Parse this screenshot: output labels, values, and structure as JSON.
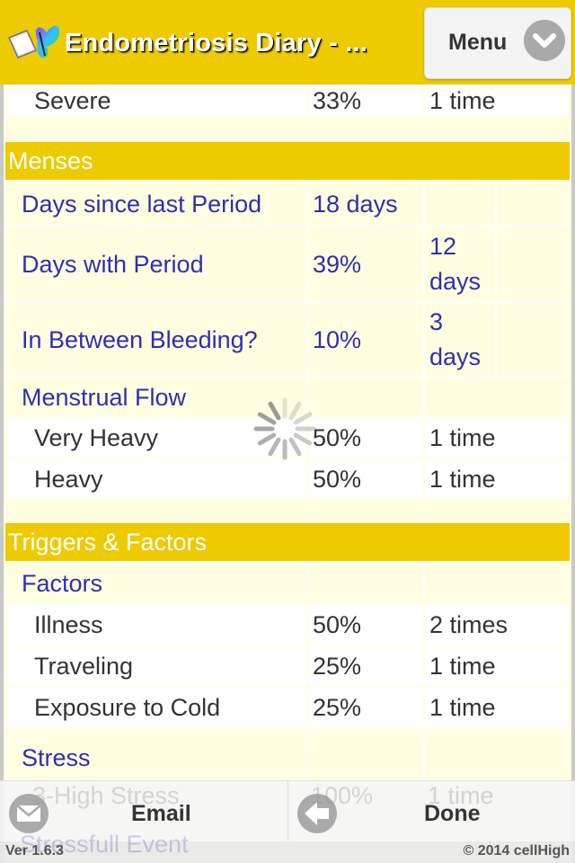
{
  "header": {
    "title": "Endometriosis Diary - ...",
    "menu_label": "Menu",
    "logo_icon": "book-butterfly-icon",
    "menu_icon": "chevron-down-circle-icon"
  },
  "rows_top": [
    {
      "label": "Severe",
      "percent": "33%",
      "count": "1 time"
    }
  ],
  "sections": [
    {
      "title": "Menses",
      "rows": [
        {
          "type": "cat",
          "label": "Days since last Period",
          "percent": "18 days",
          "count": ""
        },
        {
          "type": "cat",
          "label": "Days with Period",
          "percent": "39%",
          "count_line1": "12",
          "count_line2": "days"
        },
        {
          "type": "cat",
          "label": "In Between Bleeding?",
          "percent": "10%",
          "count_line1": "3",
          "count_line2": "days"
        },
        {
          "type": "cat",
          "label": "Menstrual Flow",
          "percent": "",
          "count": ""
        },
        {
          "type": "sub",
          "label": "Very Heavy",
          "percent": "50%",
          "count": "1 time"
        },
        {
          "type": "sub",
          "label": "Heavy",
          "percent": "50%",
          "count": "1 time"
        }
      ]
    },
    {
      "title": "Triggers & Factors",
      "rows": [
        {
          "type": "cat",
          "label": "Factors",
          "percent": "",
          "count": ""
        },
        {
          "type": "sub",
          "label": "Illness",
          "percent": "50%",
          "count": "2 times"
        },
        {
          "type": "sub",
          "label": "Traveling",
          "percent": "25%",
          "count": "1 time"
        },
        {
          "type": "sub",
          "label": "Exposure to Cold",
          "percent": "25%",
          "count": "1 time"
        },
        {
          "type": "cat",
          "label": "Stress",
          "percent": "",
          "count": ""
        },
        {
          "type": "sub",
          "label": "3-High Stress",
          "percent": "100%",
          "count": "1 time"
        },
        {
          "type": "cat",
          "label": "Stressfull Event",
          "percent": "",
          "count": ""
        }
      ]
    }
  ],
  "footer": {
    "email_label": "Email",
    "done_label": "Done",
    "email_icon": "envelope-icon",
    "done_icon": "arrow-left-icon",
    "version": "Ver 1.6.3",
    "copyright": "© 2014 cellHigh"
  },
  "colors": {
    "header_bg": "#eeca00",
    "section_bg": "#eeca00",
    "category_text": "#2f2fb0",
    "body_bg": "#fffee0"
  }
}
